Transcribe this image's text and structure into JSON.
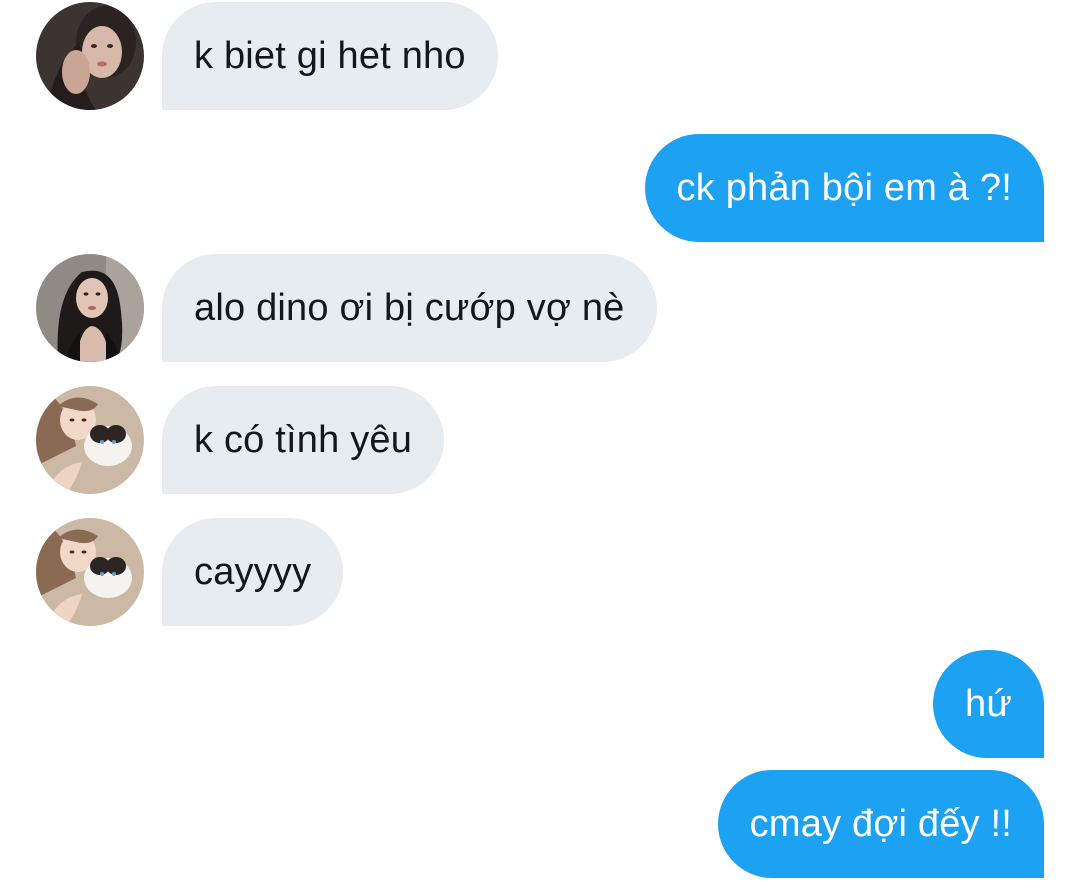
{
  "messages": [
    {
      "direction": "in",
      "avatar": "avatar-1",
      "text": "k biet gi het nho"
    },
    {
      "direction": "out",
      "text": "ck phản bội em à ?!"
    },
    {
      "direction": "in",
      "avatar": "avatar-2",
      "text": "alo dino ơi bị cướp vợ nè"
    },
    {
      "direction": "in",
      "avatar": "avatar-3",
      "text": "k có tình yêu"
    },
    {
      "direction": "in",
      "avatar": "avatar-3",
      "text": "cayyyy"
    },
    {
      "direction": "out",
      "text": "hứ"
    },
    {
      "direction": "out",
      "text": "cmay đợi đếy !!"
    }
  ],
  "colors": {
    "incoming_bubble": "#e6ecf0",
    "incoming_text": "#14171a",
    "outgoing_bubble": "#1da1f2",
    "outgoing_text": "#ffffff"
  }
}
